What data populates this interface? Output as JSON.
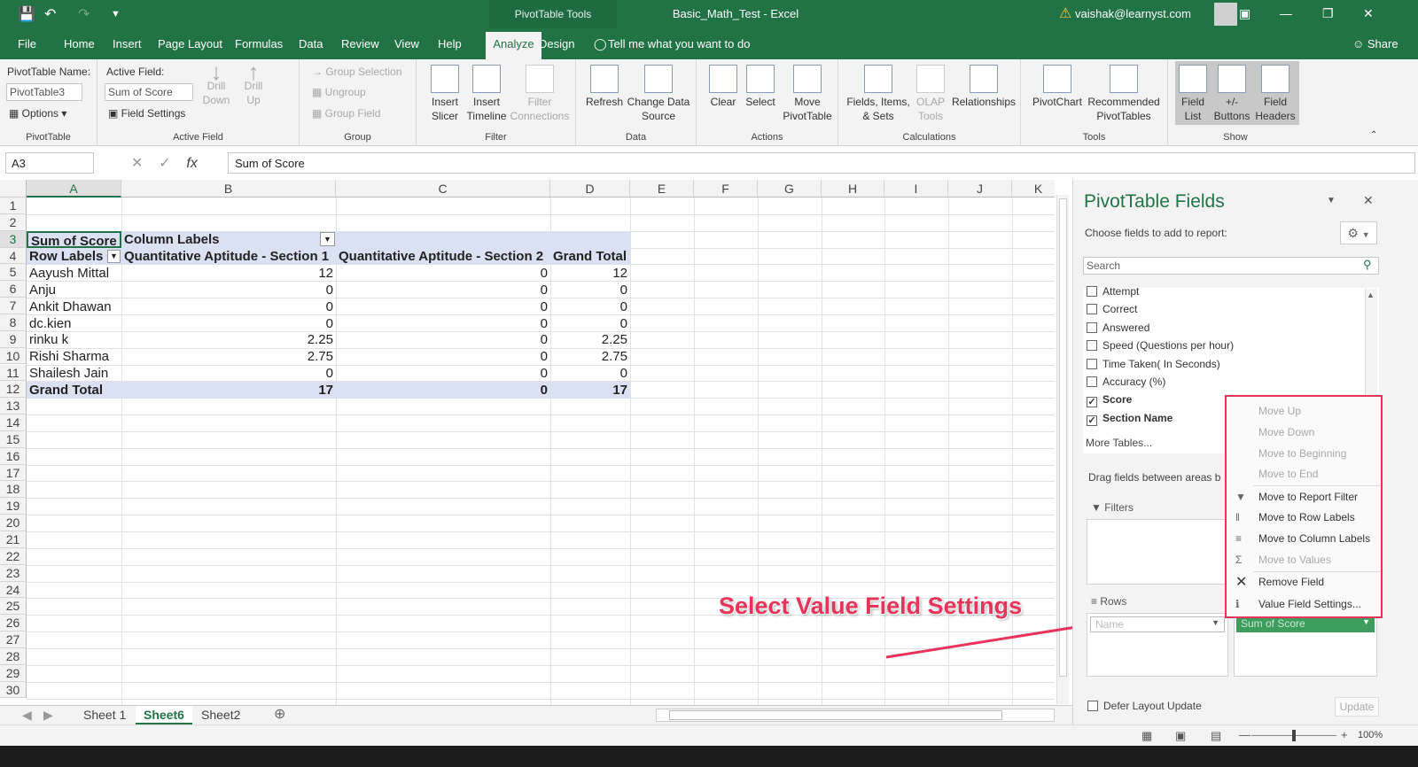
{
  "window": {
    "title": "Basic_Math_Test  -  Excel",
    "context_tab": "PivotTable Tools",
    "account": "vaishak@learnyst.com"
  },
  "menu": {
    "tabs": [
      "File",
      "Home",
      "Insert",
      "Page Layout",
      "Formulas",
      "Data",
      "Review",
      "View",
      "Help",
      "Analyze",
      "Design"
    ],
    "active": "Analyze",
    "tell_me": "Tell me what you want to do",
    "share": "Share"
  },
  "ribbon": {
    "pivottable": {
      "name_label": "PivotTable Name:",
      "name_value": "PivotTable3",
      "options": "Options",
      "group": "PivotTable"
    },
    "active_field": {
      "label": "Active Field:",
      "value": "Sum of Score",
      "field_settings": "Field Settings",
      "drill_down": "Drill\nDown",
      "drill_up": "Drill\nUp",
      "group": "Active Field"
    },
    "group_grp": {
      "group_selection": "Group Selection",
      "ungroup": "Ungroup",
      "group_field": "Group Field",
      "group": "Group"
    },
    "filter": {
      "insert_slicer": "Insert\nSlicer",
      "insert_timeline": "Insert\nTimeline",
      "filter_connections": "Filter\nConnections",
      "group": "Filter"
    },
    "data": {
      "refresh": "Refresh",
      "change_source": "Change Data\nSource",
      "group": "Data"
    },
    "actions": {
      "clear": "Clear",
      "select": "Select",
      "move": "Move\nPivotTable",
      "group": "Actions"
    },
    "calculations": {
      "fields_items": "Fields, Items,\n& Sets",
      "olap": "OLAP\nTools",
      "relationships": "Relationships",
      "group": "Calculations"
    },
    "tools": {
      "pivotchart": "PivotChart",
      "recommended": "Recommended\nPivotTables",
      "group": "Tools"
    },
    "show": {
      "field_list": "Field\nList",
      "buttons": "+/-\nButtons",
      "headers": "Field\nHeaders",
      "group": "Show"
    }
  },
  "formula_bar": {
    "name_box": "A3",
    "formula": "Sum of Score"
  },
  "grid": {
    "columns": [
      "A",
      "B",
      "C",
      "D",
      "E",
      "F",
      "G",
      "H",
      "I",
      "J",
      "K"
    ],
    "rows": [
      "1",
      "2",
      "3",
      "4",
      "5",
      "6",
      "7",
      "8",
      "9",
      "10",
      "11",
      "12",
      "13",
      "14",
      "15",
      "16",
      "17",
      "18",
      "19",
      "20",
      "21",
      "22",
      "23",
      "24",
      "25",
      "26",
      "27",
      "28",
      "29",
      "30"
    ],
    "pivot": {
      "sum_label": "Sum of Score",
      "column_labels": "Column Labels",
      "row_labels": "Row Labels",
      "col_heads": [
        "Quantitative Aptitude - Section 1",
        "Quantitative Aptitude - Section 2",
        "Grand Total"
      ],
      "rows": [
        {
          "name": "Aayush Mittal",
          "s1": "12",
          "s2": "0",
          "gt": "12"
        },
        {
          "name": "Anju",
          "s1": "0",
          "s2": "0",
          "gt": "0"
        },
        {
          "name": "Ankit Dhawan",
          "s1": "0",
          "s2": "0",
          "gt": "0"
        },
        {
          "name": "dc.kien",
          "s1": "0",
          "s2": "0",
          "gt": "0"
        },
        {
          "name": "rinku k",
          "s1": "2.25",
          "s2": "0",
          "gt": "2.25"
        },
        {
          "name": "Rishi Sharma",
          "s1": "2.75",
          "s2": "0",
          "gt": "2.75"
        },
        {
          "name": "Shailesh Jain",
          "s1": "0",
          "s2": "0",
          "gt": "0"
        }
      ],
      "grand": {
        "name": "Grand Total",
        "s1": "17",
        "s2": "0",
        "gt": "17"
      }
    }
  },
  "sheets": {
    "tabs": [
      "Sheet 1",
      "Sheet6",
      "Sheet2"
    ],
    "active": "Sheet6"
  },
  "status": {
    "zoom": "100%"
  },
  "pane": {
    "title": "PivotTable Fields",
    "subtitle": "Choose fields to add to report:",
    "search_placeholder": "Search",
    "fields": [
      {
        "label": "Attempt",
        "checked": false
      },
      {
        "label": "Correct",
        "checked": false
      },
      {
        "label": "Answered",
        "checked": false
      },
      {
        "label": "Speed (Questions per hour)",
        "checked": false
      },
      {
        "label": "Time Taken( In Seconds)",
        "checked": false
      },
      {
        "label": "Accuracy (%)",
        "checked": false
      },
      {
        "label": "Score",
        "checked": true
      },
      {
        "label": "Section Name",
        "checked": true
      }
    ],
    "more_tables": "More Tables...",
    "drag_text": "Drag fields between areas b",
    "filters": "Filters",
    "rows": "Rows",
    "rows_item": "Name",
    "values_item": "Sum of Score",
    "defer": "Defer Layout Update",
    "update": "Update"
  },
  "context_menu": {
    "items": [
      {
        "label": "Move Up",
        "enabled": false
      },
      {
        "label": "Move Down",
        "enabled": false
      },
      {
        "label": "Move to Beginning",
        "enabled": false
      },
      {
        "label": "Move to End",
        "enabled": false
      },
      {
        "label": "Move to Report Filter",
        "enabled": true
      },
      {
        "label": "Move to Row Labels",
        "enabled": true
      },
      {
        "label": "Move to Column Labels",
        "enabled": true
      },
      {
        "label": "Move to Values",
        "enabled": false
      },
      {
        "label": "Remove Field",
        "enabled": true
      },
      {
        "label": "Value Field Settings...",
        "enabled": true
      }
    ]
  },
  "annotation": {
    "text": "Select Value Field Settings",
    "color": "#e8345a"
  },
  "colors": {
    "excel_green": "#217346",
    "pivot_header": "#d9e1f2",
    "annotation": "#e8345a"
  }
}
